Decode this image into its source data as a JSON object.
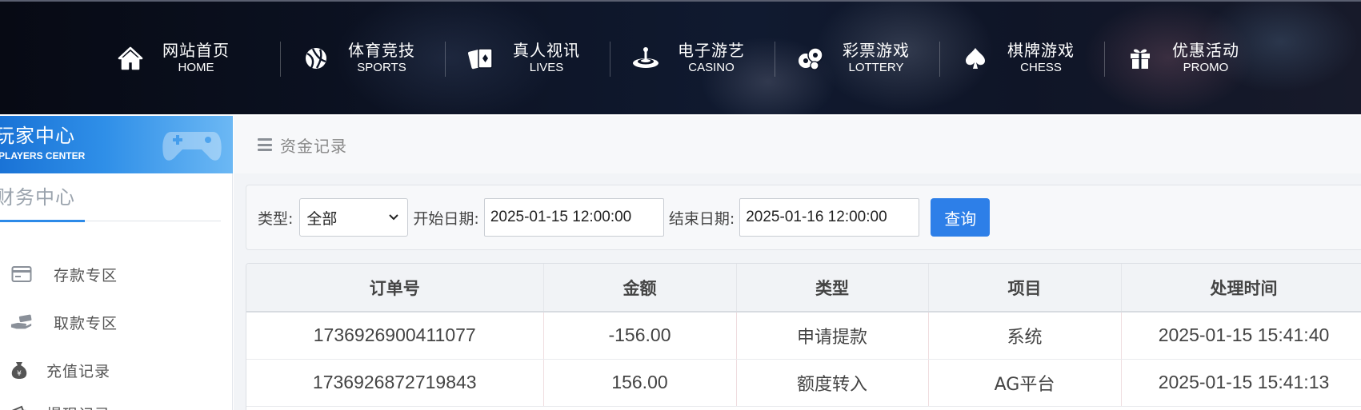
{
  "nav": {
    "items": [
      {
        "cn": "网站首页",
        "en": "HOME",
        "icon": "home-icon"
      },
      {
        "cn": "体育竞技",
        "en": "SPORTS",
        "icon": "sports-ball-icon"
      },
      {
        "cn": "真人视讯",
        "en": "LIVES",
        "icon": "cards-icon"
      },
      {
        "cn": "电子游艺",
        "en": "CASINO",
        "icon": "slot-machine-icon"
      },
      {
        "cn": "彩票游戏",
        "en": "LOTTERY",
        "icon": "lottery-balls-icon"
      },
      {
        "cn": "棋牌游戏",
        "en": "CHESS",
        "icon": "spade-icon"
      },
      {
        "cn": "优惠活动",
        "en": "PROMO",
        "icon": "gift-icon"
      }
    ]
  },
  "sidebar": {
    "banner_cn": "玩家中心",
    "banner_en": "PLAYERS CENTER",
    "section_title": "财务中心",
    "items": [
      {
        "label": "存款专区",
        "icon": "card-icon"
      },
      {
        "label": "取款专区",
        "icon": "hand-cash-icon"
      },
      {
        "label": "充值记录",
        "icon": "money-bag-icon"
      },
      {
        "label": "提现记录",
        "icon": "wallet-icon"
      }
    ]
  },
  "breadcrumb": {
    "title": "资金记录"
  },
  "filter": {
    "type_label": "类型:",
    "type_value": "全部",
    "start_label": "开始日期:",
    "start_value": "2025-01-15 12:00:00",
    "end_label": "结束日期:",
    "end_value": "2025-01-16 12:00:00",
    "query_label": "查询"
  },
  "table": {
    "headers": [
      "订单号",
      "金额",
      "类型",
      "项目",
      "处理时间"
    ],
    "rows": [
      [
        "1736926900411077",
        "-156.00",
        "申请提款",
        "系统",
        "2025-01-15 15:41:40"
      ],
      [
        "1736926872719843",
        "156.00",
        "额度转入",
        "AG平台",
        "2025-01-15 15:41:13"
      ]
    ]
  },
  "colors": {
    "accent": "#2d7fe8",
    "banner_blue": "#1a73d6",
    "nav_bg": "#0d1426"
  }
}
